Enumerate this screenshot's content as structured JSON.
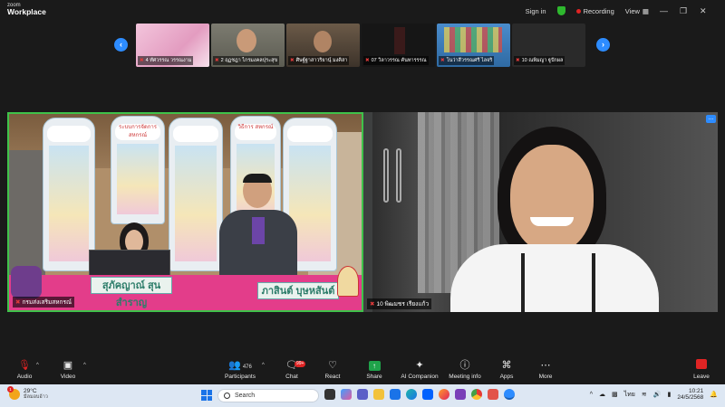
{
  "app": {
    "brand_top": "zoom",
    "brand_bottom": "Workplace"
  },
  "titlebar": {
    "sign_in": "Sign in",
    "recording": "Recording",
    "view": "View",
    "status_color": "#2eb82e",
    "recording_color": "#e02424"
  },
  "thumbnails": [
    {
      "name": "4 ทัศวรรณ วรรณงาม",
      "bg": "#e8a9c7"
    },
    {
      "name": "2 ฤฏชฎา ไกรมงคลปุระสุข",
      "bg": "#6f6f62"
    },
    {
      "name": "ศิษฐ์ฐาสาวริยานุ์ มงคิสา",
      "bg": "#5a4a3a"
    },
    {
      "name": "07 วิลาวรรณ คันทารรรณ",
      "bg": "#1e1e1e"
    },
    {
      "name": "โนว่าสีวรรณศรี ไลจริ",
      "bg": "#3a7ab8"
    },
    {
      "name": "10 ณพิมญา ฐูปักผล",
      "bg": "#2a2a2a"
    }
  ],
  "nav": {
    "prev_icon": "chevron-left-icon",
    "next_icon": "chevron-right-icon"
  },
  "videos": {
    "left": {
      "label": "กรมส่งเสริมสหกรณ์",
      "nameplate_1": "สุภัคญาณ์ สุนสำราญ",
      "nameplate_2": "ภาสินต์ บุษหสันต์",
      "poster_1": "ระบบการจัดการสหกรณ์",
      "poster_2": "วิธีการ สหกรณ์",
      "active_border": "#3fc24a"
    },
    "right": {
      "label": "10 พิฒมชร เรียงแก้ว",
      "more": "..."
    }
  },
  "toolbar": {
    "audio": "Audio",
    "video": "Video",
    "participants": "Participants",
    "participants_count": "476",
    "chat": "Chat",
    "chat_badge": "99+",
    "react": "React",
    "share": "Share",
    "ai_companion": "AI Companion",
    "meeting_info": "Meeting info",
    "apps": "Apps",
    "more": "More",
    "leave": "Leave"
  },
  "taskbar": {
    "temperature": "29°C",
    "weather_text": "มีลมอบอ้าว",
    "weather_badge": "1",
    "search_placeholder": "Search",
    "language": "ไทย",
    "time": "10:21",
    "date": "24/5/2568"
  }
}
